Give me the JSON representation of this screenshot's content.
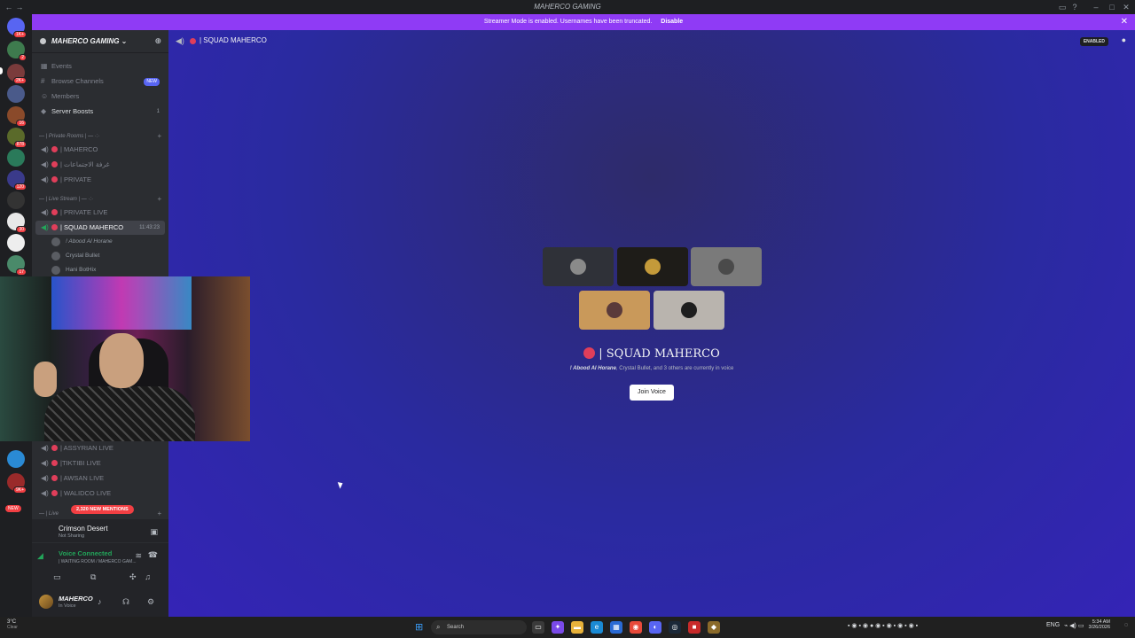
{
  "window": {
    "title": "MAHERCO GAMING"
  },
  "banner": {
    "text": "Streamer Mode is enabled. Usernames have been truncated.",
    "disable_label": "Disable"
  },
  "rail": {
    "servers": [
      {
        "name": "home",
        "badge": "1K+",
        "color": "#5865f2"
      },
      {
        "name": "server-2",
        "badge": "2",
        "color": "#3e7b4e"
      },
      {
        "name": "server-3",
        "badge": "2K+",
        "color": "#7a3b3b"
      },
      {
        "name": "server-4",
        "badge": "",
        "color": "#4a5a8a"
      },
      {
        "name": "server-5",
        "badge": "16",
        "color": "#8a4a2a"
      },
      {
        "name": "server-6",
        "badge": "878",
        "color": "#5a6a2a"
      },
      {
        "name": "server-7",
        "badge": "",
        "color": "#2a7a5a"
      },
      {
        "name": "server-8",
        "badge": "120",
        "color": "#3a3a8a"
      },
      {
        "name": "server-9",
        "badge": "",
        "color": "#333333"
      },
      {
        "name": "server-10",
        "badge": "30",
        "color": "#e8e8e8"
      },
      {
        "name": "server-11",
        "badge": "",
        "color": "#eeeeee"
      },
      {
        "name": "server-12",
        "badge": "17",
        "color": "#4a8a6a"
      },
      {
        "name": "server-13",
        "badge": "",
        "color": "#2a8ad4"
      },
      {
        "name": "server-14",
        "badge": "9K+",
        "color": "#9a2a2a"
      }
    ],
    "new_label": "NEW"
  },
  "sidebar": {
    "server_name": "MAHERCO GAMING",
    "items": [
      {
        "label": "Events",
        "icon": "calendar-icon"
      },
      {
        "label": "Browse Channels",
        "icon": "browse-icon",
        "tag": "NEW"
      },
      {
        "label": "Members",
        "icon": "members-icon"
      },
      {
        "label": "Server Boosts",
        "icon": "boost-icon",
        "count": "1"
      }
    ],
    "categories": [
      {
        "label": "— | Private Rooms | — ·:·"
      },
      {
        "label": "— | Live Stream | — ·:·"
      },
      {
        "label": "— | Live"
      }
    ],
    "private_rooms": [
      "| MAHERCO",
      "| غرفة الاجتماعات",
      "| PRIVATE"
    ],
    "live_channels": [
      "| PRIVATE LIVE",
      "| SQUAD MAHERCO"
    ],
    "selected_time": "11:43:23",
    "voice_users": [
      "! Abood Al Horane",
      "Crystal Bullet",
      "Hani BotHix"
    ],
    "more_channels": [
      "| ASSYRIAN LIVE",
      "|TIKTIBI LIVE",
      "| AWSAN LIVE",
      "| WALIDCO LIVE"
    ],
    "mentions_label": "2,320 NEW MENTIONS"
  },
  "panel": {
    "activity_name": "Crimson Desert",
    "activity_sub": "Not Sharing",
    "voice_status": "Voice Connected",
    "voice_channel": "| WAITING ROOM / MAHERCO GAM...",
    "user_name": "MAHERCO",
    "user_status": "In Voice"
  },
  "main": {
    "channel": "| SQUAD MAHERCO",
    "enabled_label": "ENABLED",
    "tiles": [
      {
        "bg": "#2f3138",
        "avatar": "#8a8a8a"
      },
      {
        "bg": "#1e1c18",
        "avatar": "#c49a3a"
      },
      {
        "bg": "#7a7a7a",
        "avatar": "#4a4a4a"
      },
      {
        "bg": "#c9995a",
        "avatar": "#5a3a3a"
      },
      {
        "bg": "#b9b4ae",
        "avatar": "#1e1e1e"
      }
    ],
    "voice_title": "| SQUAD MAHERCO",
    "voice_sub_user": "! Abood Al Horane",
    "voice_sub_rest": ", Crystal Bullet, and 3 others are currently in voice",
    "join_label": "Join Voice"
  },
  "taskbar": {
    "weather_temp": "3°C",
    "weather_sub": "Clear",
    "search_placeholder": "Search",
    "lang": "ENG",
    "time": "5:34 AM",
    "date": "3/26/2026"
  }
}
